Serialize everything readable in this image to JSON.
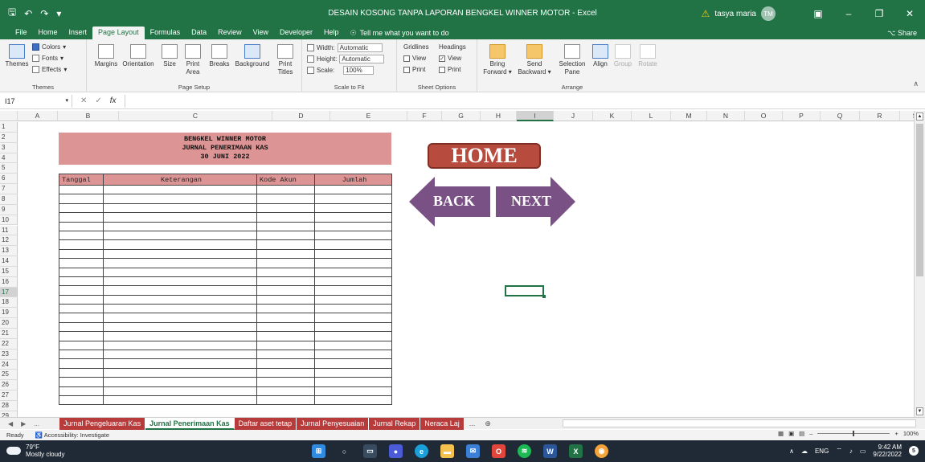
{
  "window": {
    "title": "DESAIN KOSONG TANPA  LAPORAN BENGKEL WINNER MOTOR  -  Excel",
    "user_name": "tasya maria",
    "user_initials": "TM"
  },
  "menu_tabs": [
    "File",
    "Home",
    "Insert",
    "Page Layout",
    "Formulas",
    "Data",
    "Review",
    "View",
    "Developer",
    "Help"
  ],
  "active_tab": "Page Layout",
  "tell_me": "Tell me what you want to do",
  "share_label": "Share",
  "ribbon": {
    "themes": {
      "themes": "Themes",
      "colors": "Colors",
      "fonts": "Fonts",
      "effects": "Effects",
      "label": "Themes"
    },
    "page_setup": {
      "margins": "Margins",
      "orientation": "Orientation",
      "size": "Size",
      "print_area_1": "Print",
      "print_area_2": "Area",
      "breaks": "Breaks",
      "background": "Background",
      "print_titles_1": "Print",
      "print_titles_2": "Titles",
      "label": "Page Setup"
    },
    "scale_to_fit": {
      "width_label": "Width:",
      "width_value": "Automatic",
      "height_label": "Height:",
      "height_value": "Automatic",
      "scale_label": "Scale:",
      "scale_value": "100%",
      "label": "Scale to Fit"
    },
    "sheet_options": {
      "gridlines": "Gridlines",
      "headings": "Headings",
      "view": "View",
      "print": "Print",
      "label": "Sheet Options"
    },
    "arrange": {
      "bring_1": "Bring",
      "bring_2": "Forward",
      "send_1": "Send",
      "send_2": "Backward",
      "selection_1": "Selection",
      "selection_2": "Pane",
      "align": "Align",
      "group": "Group",
      "rotate": "Rotate",
      "label": "Arrange"
    }
  },
  "formula_bar": {
    "name_box": "I17",
    "cancel": "✕",
    "enter": "✓",
    "fx": "fx",
    "content": ""
  },
  "columns": [
    "A",
    "B",
    "C",
    "D",
    "E",
    "F",
    "G",
    "H",
    "I",
    "J",
    "K",
    "L",
    "M",
    "N",
    "O",
    "P",
    "Q",
    "R",
    "S"
  ],
  "rows": [
    "1",
    "2",
    "3",
    "4",
    "5",
    "6",
    "7",
    "8",
    "9",
    "10",
    "11",
    "12",
    "13",
    "14",
    "15",
    "16",
    "17",
    "18",
    "19",
    "20",
    "21",
    "22",
    "23",
    "24",
    "25",
    "26",
    "27",
    "28",
    "29"
  ],
  "journal": {
    "company": "BENGKEL WINNER MOTOR",
    "title": "JURNAL PENERIMAAN KAS",
    "date": "30 JUNI 2022",
    "headers": [
      "Tanggal",
      "Keterangan",
      "Kode Akun",
      "Jumlah"
    ]
  },
  "buttons": {
    "home": "HOME",
    "back": "BACK",
    "next": "NEXT"
  },
  "sheet_tabs": [
    "Jurnal Pengeluaran Kas",
    "Jurnal Penerimaan Kas",
    "Daftar aset tetap",
    "Jurnal Penyesuaian",
    "Jurnal Rekap",
    "Neraca Laj"
  ],
  "active_sheet": "Jurnal Penerimaan Kas",
  "sheet_more": "...",
  "status": {
    "ready": "Ready",
    "accessibility": "Accessibility: Investigate",
    "zoom": "100%"
  },
  "taskbar": {
    "temp": "79°F",
    "weather": "Mostly cloudy",
    "lang": "ENG",
    "time": "9:42 AM",
    "date": "9/22/2022",
    "notifications": "5"
  },
  "colors": {
    "excel_green": "#217346",
    "header_fill": "#dc9494",
    "home_button": "#b74c3e",
    "arrow_purple": "#7a5185",
    "sheet_tab_red": "#b73b3b"
  }
}
